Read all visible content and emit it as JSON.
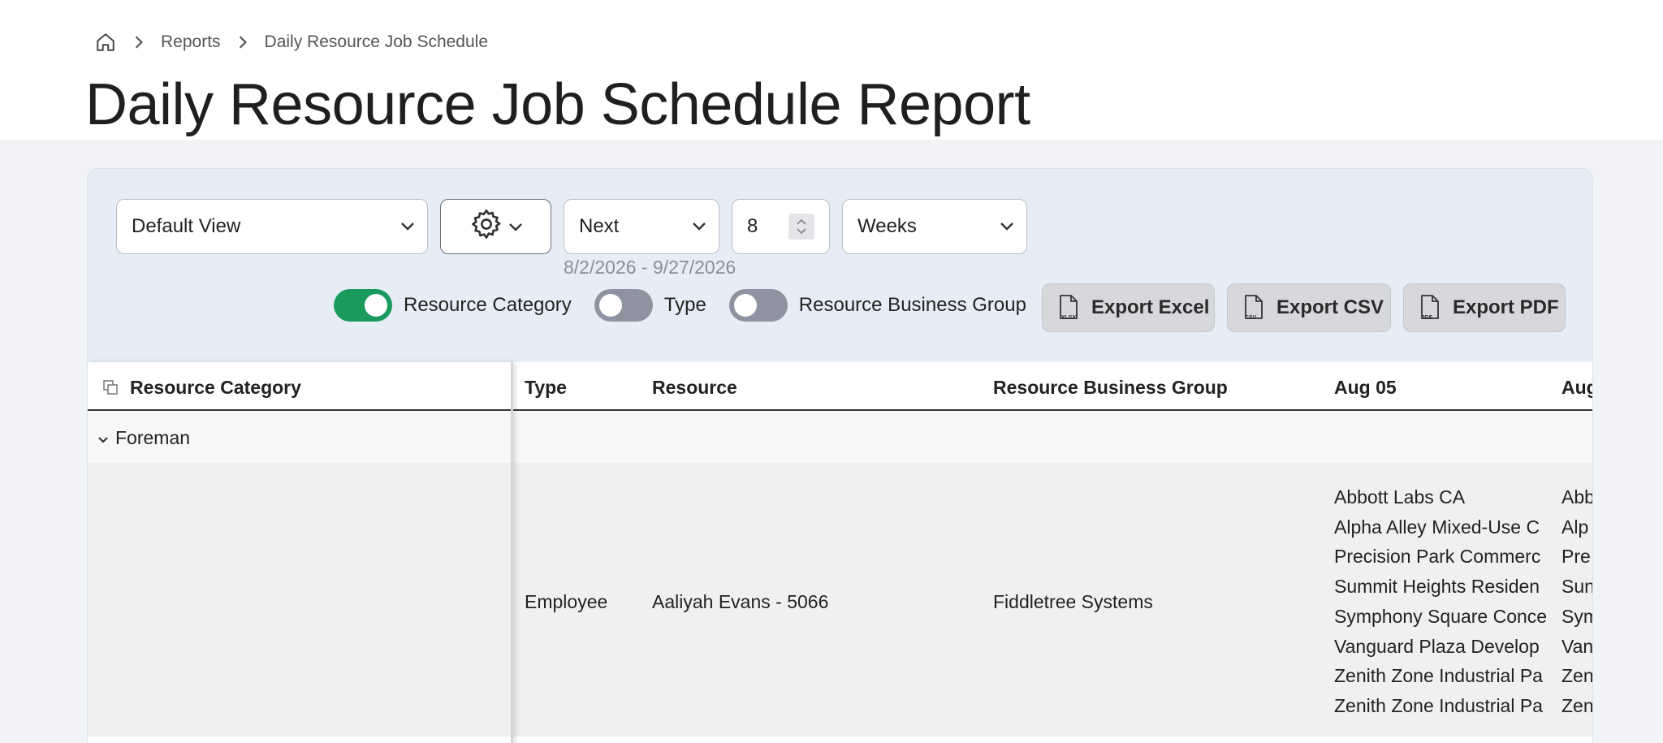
{
  "breadcrumb": {
    "items": [
      "Reports",
      "Daily Resource Job Schedule"
    ]
  },
  "page": {
    "title": "Daily Resource Job Schedule Report"
  },
  "toolbar": {
    "view_value": "Default View",
    "period_value": "Next",
    "count_value": "8",
    "unit_value": "Weeks",
    "date_range": "8/2/2026 - 9/27/2026",
    "toggles": [
      {
        "label": "Resource Category",
        "on": true
      },
      {
        "label": "Type",
        "on": false
      },
      {
        "label": "Resource Business Group",
        "on": false
      }
    ],
    "exports": [
      {
        "label": "Export Excel",
        "icon_text": "XLSX"
      },
      {
        "label": "Export CSV",
        "icon_text": "CSV"
      },
      {
        "label": "Export PDF",
        "icon_text": "PDF"
      }
    ]
  },
  "grid": {
    "columns": [
      "Resource Category",
      "Type",
      "Resource",
      "Resource Business Group",
      "Aug 05",
      "Aug"
    ],
    "group": {
      "label": "Foreman"
    },
    "row": {
      "type": "Employee",
      "resource": "Aaliyah Evans - 5066",
      "business_group": "Fiddletree Systems",
      "aug05_jobs": [
        "Abbott Labs CA",
        "Alpha Alley Mixed-Use C",
        "Precision Park Commerc",
        "Summit Heights Residen",
        "Symphony Square Conce",
        "Vanguard Plaza Develop",
        "Zenith Zone Industrial Pa",
        "Zenith Zone Industrial Pa"
      ],
      "aug_next_jobs": [
        "Abb",
        "Alp",
        "Pre",
        "Sun",
        "Sym",
        "Van",
        "Zen",
        "Zen"
      ]
    }
  },
  "colors": {
    "toggle_on": "#1a9a5c",
    "toggle_off": "#8f93a1",
    "panel_bg": "#e6edf7"
  }
}
